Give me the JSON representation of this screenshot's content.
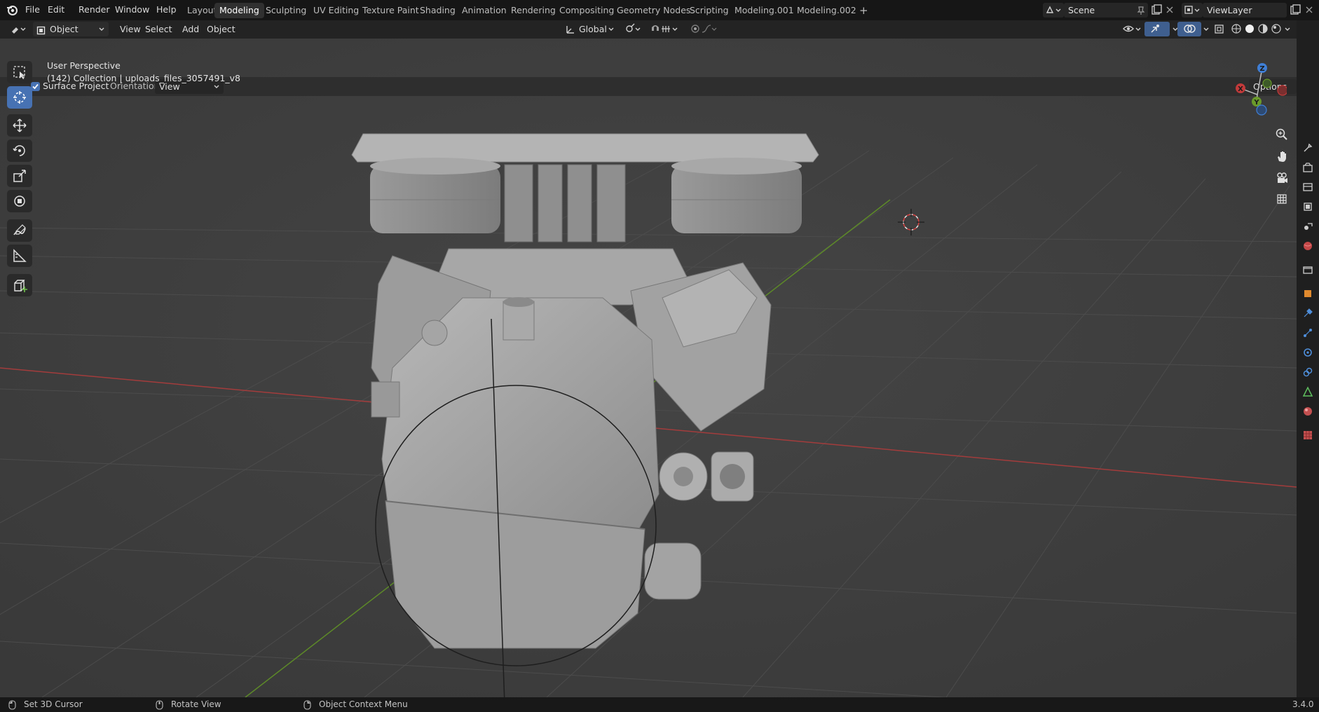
{
  "menu": {
    "file": "File",
    "edit": "Edit",
    "render": "Render",
    "window": "Window",
    "help": "Help"
  },
  "workspace_tabs": [
    {
      "label": "Layout"
    },
    {
      "label": "Modeling"
    },
    {
      "label": "Sculpting"
    },
    {
      "label": "UV Editing"
    },
    {
      "label": "Texture Paint"
    },
    {
      "label": "Shading"
    },
    {
      "label": "Animation"
    },
    {
      "label": "Rendering"
    },
    {
      "label": "Compositing"
    },
    {
      "label": "Geometry Nodes"
    },
    {
      "label": "Scripting"
    },
    {
      "label": "Modeling.001"
    },
    {
      "label": "Modeling.002"
    }
  ],
  "active_tab": "Modeling",
  "add_workspace": "+",
  "scene": {
    "name": "Scene"
  },
  "view_layer": {
    "name": "ViewLayer"
  },
  "header": {
    "mode": "Object Mode",
    "view": "View",
    "select": "Select",
    "add": "Add",
    "object": "Object",
    "transform_orientation": "Global",
    "options": "Options"
  },
  "tool_settings": {
    "surface_project_label": "Surface Project",
    "surface_project_checked": true,
    "orientation_label": "Orientation:",
    "orientation_value": "View"
  },
  "viewport": {
    "perspective_label": "User Perspective",
    "collection_label": "(142) Collection | uploads_files_3057491_v8"
  },
  "gizmo": {
    "z": "Z",
    "y": "Y",
    "x": "X"
  },
  "status_bar": {
    "left_action": "Set 3D Cursor",
    "middle_action": "Rotate View",
    "right_action": "Object Context Menu",
    "version": "3.4.0"
  },
  "colors": {
    "accent_blue": "#4772b3",
    "axis_x": "#c23a3a",
    "axis_y": "#6a9a2a",
    "axis_z": "#3f7fd6",
    "viewport_bg": "#3d3d3d"
  }
}
